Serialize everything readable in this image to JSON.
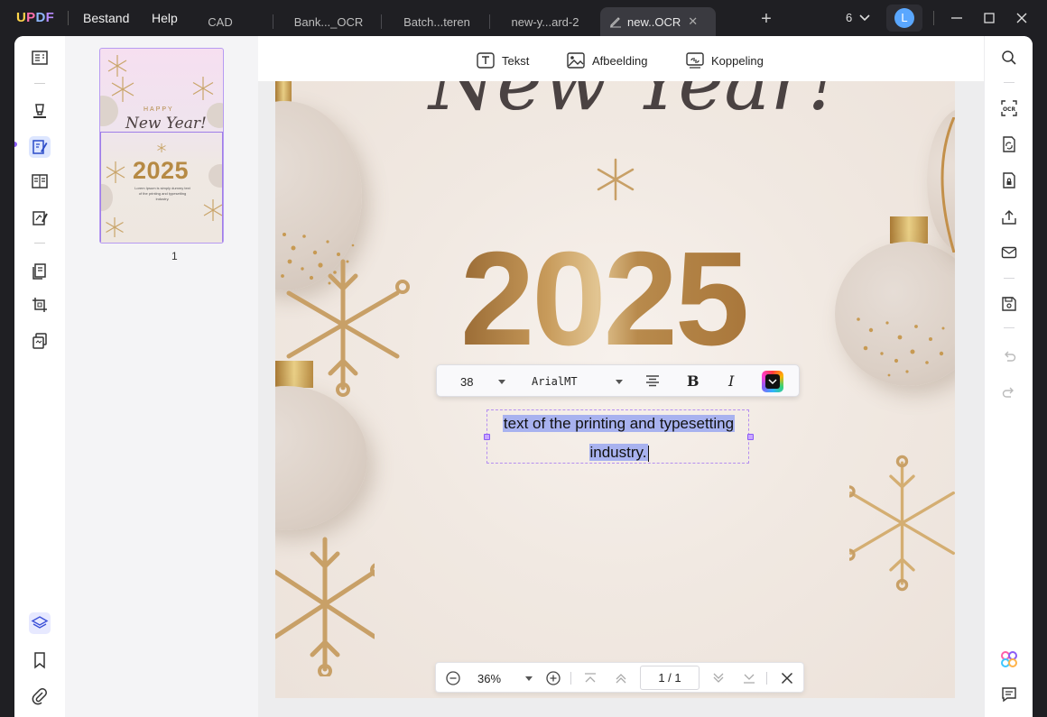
{
  "app": {
    "logo": "UPDF"
  },
  "menu": {
    "file": "Bestand",
    "help": "Help"
  },
  "tabs": [
    {
      "label": "CAD"
    },
    {
      "label": "Bank..._OCR"
    },
    {
      "label": "Batch...teren"
    },
    {
      "label": "new-y...ard-2"
    },
    {
      "label": "new..OCR",
      "active": true
    }
  ],
  "titlebar": {
    "page_count": "6",
    "user_initial": "L"
  },
  "edit_toolbar": {
    "text_label": "Tekst",
    "image_label": "Afbeelding",
    "link_label": "Koppeling"
  },
  "thumbnail": {
    "page_number": "1",
    "happy": "HAPPY",
    "heading": "New Year!",
    "year": "2025",
    "lorem": "Lorem Ipsum is simply dummy text of the printing and typesetting industry."
  },
  "document": {
    "year": "2025",
    "heading_fragment": "New Year!",
    "selected_text_line1": "text of the printing and typesetting",
    "selected_text_line2": "industry."
  },
  "format_bar": {
    "font_size": "38",
    "font_name": "ArialMT",
    "bold": "B",
    "italic": "I"
  },
  "zoom_bar": {
    "zoom": "36%",
    "page_indicator": "1 / 1"
  },
  "colors": {
    "accent": "#8b5cf6",
    "selection": "#a8b2ef",
    "gold": "#b68a44"
  }
}
